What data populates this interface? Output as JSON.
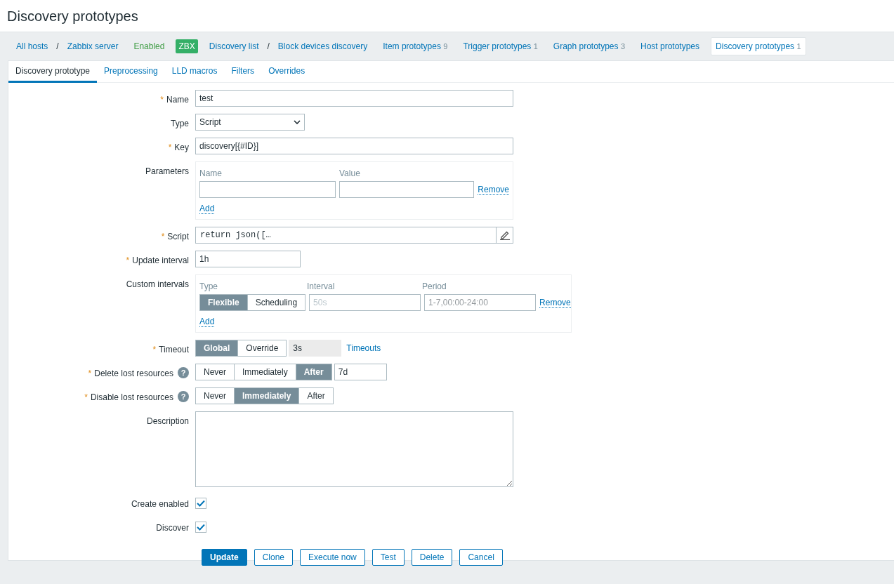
{
  "title": "Discovery prototypes",
  "breadcrumbs": [
    {
      "kind": "link",
      "label": "All hosts",
      "selected": false
    },
    {
      "kind": "separator",
      "label": "/"
    },
    {
      "kind": "link",
      "label": "Zabbix server",
      "selected": false
    },
    {
      "kind": "status",
      "label": "Enabled"
    },
    {
      "kind": "badge",
      "label": "ZBX"
    },
    {
      "kind": "link",
      "label": "Discovery list",
      "selected": false
    },
    {
      "kind": "separator",
      "label": "/"
    },
    {
      "kind": "link",
      "label": "Block devices discovery",
      "selected": false
    },
    {
      "kind": "link",
      "label": "Item prototypes",
      "count": "9",
      "selected": false
    },
    {
      "kind": "link",
      "label": "Trigger prototypes",
      "count": "1",
      "selected": false
    },
    {
      "kind": "link",
      "label": "Graph prototypes",
      "count": "3",
      "selected": false
    },
    {
      "kind": "link",
      "label": "Host prototypes",
      "selected": false
    },
    {
      "kind": "link",
      "label": "Discovery prototypes",
      "count": "1",
      "selected": true
    }
  ],
  "tabs": [
    {
      "label": "Discovery prototype",
      "selected": true
    },
    {
      "label": "Preprocessing",
      "selected": false
    },
    {
      "label": "LLD macros",
      "selected": false
    },
    {
      "label": "Filters",
      "selected": false
    },
    {
      "label": "Overrides",
      "selected": false
    }
  ],
  "form": [
    {
      "kind": "text",
      "marker": "*",
      "label": "Name",
      "value": "test"
    },
    {
      "kind": "select",
      "label": "Type",
      "value": "Script"
    },
    {
      "kind": "text",
      "marker": "*",
      "label": "Key",
      "value": "discovery[{#ID}]"
    },
    {
      "kind": "params",
      "label": "Parameters",
      "columns": [
        "Name",
        "Value"
      ],
      "rows": [
        {
          "remove": "Remove"
        }
      ],
      "add": "Add"
    },
    {
      "kind": "script",
      "marker": "*",
      "label": "Script",
      "value": "return json([…"
    },
    {
      "kind": "duration",
      "marker": "*",
      "label": "Update interval",
      "value": "1h"
    },
    {
      "kind": "intervals",
      "label": "Custom intervals",
      "columns": [
        "Type",
        "Interval",
        "Period"
      ],
      "rows": [
        {
          "options": [
            {
              "label": "Flexible",
              "selected": true
            },
            {
              "label": "Scheduling",
              "selected": false
            }
          ],
          "interval_placeholder": "50s",
          "period_placeholder": "1-7,00:00-24:00",
          "remove": "Remove"
        }
      ],
      "add": "Add"
    },
    {
      "kind": "segmented",
      "marker": "*",
      "label": "Timeout",
      "options": [
        {
          "label": "Global",
          "selected": true
        },
        {
          "label": "Override",
          "selected": false
        }
      ],
      "field": {
        "value": "3s",
        "disabled": true
      },
      "link": "Timeouts"
    },
    {
      "kind": "segmented",
      "marker": "*",
      "label": "Delete lost resources",
      "help": "?",
      "options": [
        {
          "label": "Never",
          "selected": false
        },
        {
          "label": "Immediately",
          "selected": false
        },
        {
          "label": "After",
          "selected": true
        }
      ],
      "field": {
        "value": "7d",
        "disabled": false
      }
    },
    {
      "kind": "segmented",
      "marker": "*",
      "label": "Disable lost resources",
      "help": "?",
      "options": [
        {
          "label": "Never",
          "selected": false
        },
        {
          "label": "Immediately",
          "selected": true
        },
        {
          "label": "After",
          "selected": false
        }
      ]
    },
    {
      "kind": "textarea",
      "label": "Description"
    },
    {
      "kind": "checkbox",
      "label": "Create enabled",
      "checked": true
    },
    {
      "kind": "checkbox",
      "label": "Discover",
      "checked": true
    }
  ],
  "buttons": [
    {
      "label": "Update",
      "primary": true
    },
    {
      "label": "Clone",
      "primary": false
    },
    {
      "label": "Execute now",
      "primary": false
    },
    {
      "label": "Test",
      "primary": false
    },
    {
      "label": "Delete",
      "primary": false
    },
    {
      "label": "Cancel",
      "primary": false
    }
  ]
}
